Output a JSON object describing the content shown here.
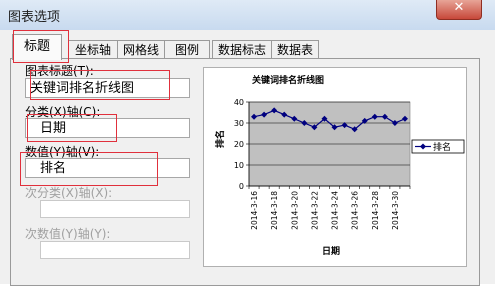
{
  "window": {
    "title": "图表选项",
    "close_glyph": "✕"
  },
  "tabs": [
    {
      "label": "标题"
    },
    {
      "label": "坐标轴"
    },
    {
      "label": "网格线"
    },
    {
      "label": "图例"
    },
    {
      "label": "数据标志"
    },
    {
      "label": "数据表"
    }
  ],
  "form": {
    "chart_title_label": "图表标题(T):",
    "chart_title_value": "关键词排名折线图",
    "category_x_label": "分类(X)轴(C):",
    "category_x_value": "日期",
    "value_y_label": "数值(Y)轴(V):",
    "value_y_value": "排名",
    "secondary_x_label": "次分类(X)轴(X):",
    "secondary_x_value": "",
    "secondary_y_label": "次数值(Y)轴(Y):",
    "secondary_y_value": ""
  },
  "chart_data": {
    "type": "line",
    "title": "关键词排名折线图",
    "xlabel": "日期",
    "ylabel": "排名",
    "x": [
      "2014-3-16",
      "2014-3-17",
      "2014-3-18",
      "2014-3-19",
      "2014-3-20",
      "2014-3-21",
      "2014-3-22",
      "2014-3-23",
      "2014-3-24",
      "2014-3-25",
      "2014-3-26",
      "2014-3-27",
      "2014-3-28",
      "2014-3-29",
      "2014-3-30",
      "2014-3-31"
    ],
    "x_tick_labels": [
      "2014-3-16",
      "2014-3-18",
      "2014-3-20",
      "2014-3-22",
      "2014-3-24",
      "2014-3-26",
      "2014-3-28",
      "2014-3-30"
    ],
    "y_ticks": [
      "0",
      "10",
      "20",
      "30",
      "40"
    ],
    "ylim": [
      0,
      40
    ],
    "series": [
      {
        "name": "排名",
        "values": [
          33,
          34,
          36,
          34,
          32,
          30,
          28,
          32,
          28,
          29,
          27,
          31,
          33,
          33,
          30,
          32
        ]
      }
    ],
    "grid": true,
    "legend_position": "right",
    "colors": {
      "plot_area": "#c0c0c0",
      "line": "#00007f",
      "marker": "#00007f"
    }
  },
  "colors": {
    "highlight_box": "#e0303c"
  }
}
